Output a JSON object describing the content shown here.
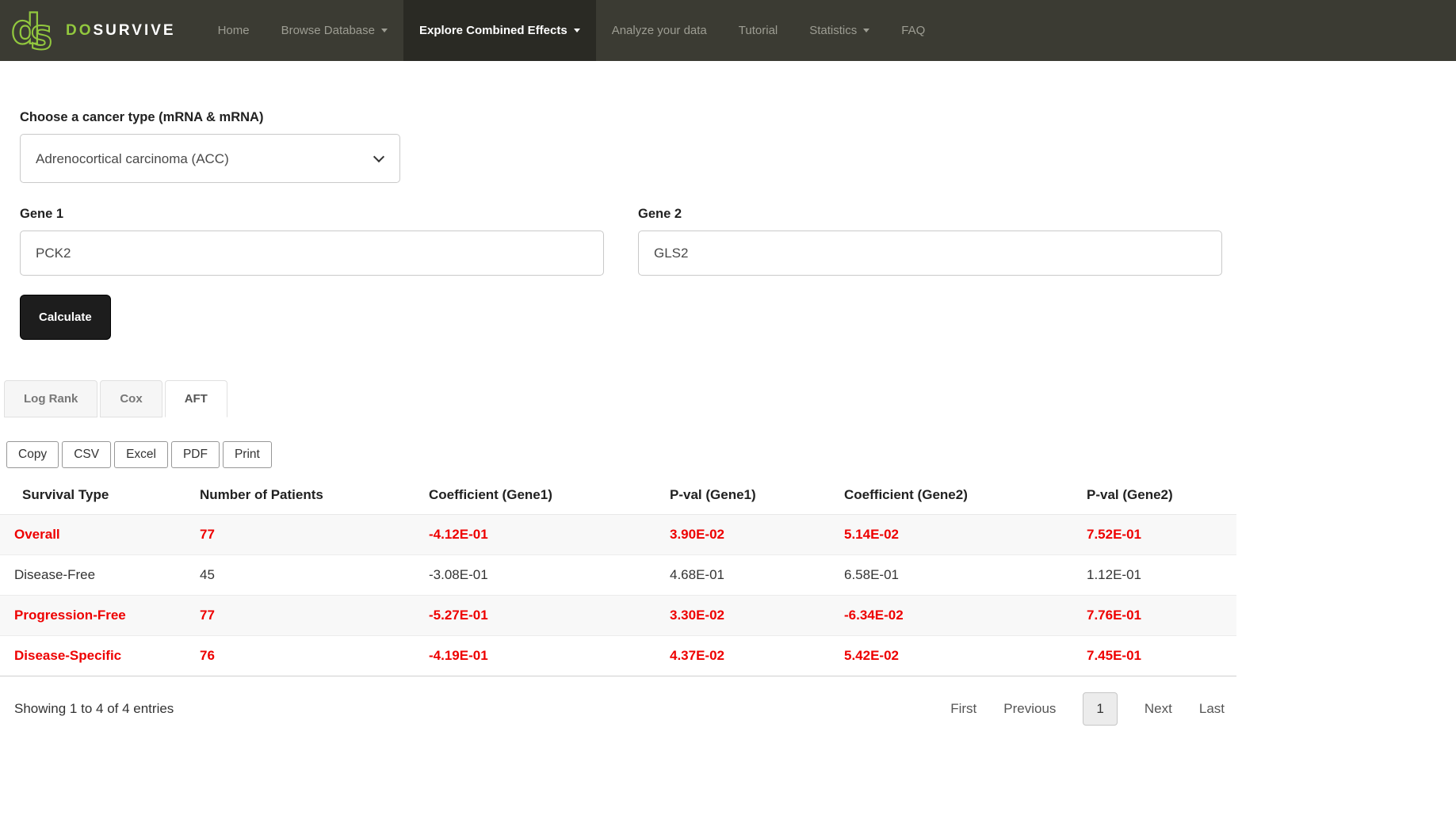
{
  "brand": {
    "green": "DO",
    "white": "SURVIVE"
  },
  "nav": {
    "items": [
      {
        "label": "Home"
      },
      {
        "label": "Browse Database"
      },
      {
        "label": "Explore Combined Effects"
      },
      {
        "label": "Analyze your data"
      },
      {
        "label": "Tutorial"
      },
      {
        "label": "Statistics"
      },
      {
        "label": "FAQ"
      }
    ]
  },
  "form": {
    "cancer_label": "Choose a cancer type (mRNA & mRNA)",
    "cancer_value": "Adrenocortical carcinoma (ACC)",
    "gene1_label": "Gene 1",
    "gene1_value": "PCK2",
    "gene2_label": "Gene 2",
    "gene2_value": "GLS2",
    "calculate_label": "Calculate"
  },
  "tabs": [
    {
      "label": "Log Rank"
    },
    {
      "label": "Cox"
    },
    {
      "label": "AFT"
    }
  ],
  "export_buttons": [
    "Copy",
    "CSV",
    "Excel",
    "PDF",
    "Print"
  ],
  "table": {
    "headers": [
      "Survival Type",
      "Number of Patients",
      "Coefficient (Gene1)",
      "P-val (Gene1)",
      "Coefficient (Gene2)",
      "P-val (Gene2)"
    ],
    "rows": [
      {
        "cells": [
          "Overall",
          "77",
          "-4.12E-01",
          "3.90E-02",
          "5.14E-02",
          "7.52E-01"
        ],
        "significant": true
      },
      {
        "cells": [
          "Disease-Free",
          "45",
          "-3.08E-01",
          "4.68E-01",
          "6.58E-01",
          "1.12E-01"
        ],
        "significant": false
      },
      {
        "cells": [
          "Progression-Free",
          "77",
          "-5.27E-01",
          "3.30E-02",
          "-6.34E-02",
          "7.76E-01"
        ],
        "significant": true
      },
      {
        "cells": [
          "Disease-Specific",
          "76",
          "-4.19E-01",
          "4.37E-02",
          "5.42E-02",
          "7.45E-01"
        ],
        "significant": true
      }
    ]
  },
  "footer": {
    "info": "Showing 1 to 4 of 4 entries",
    "first": "First",
    "previous": "Previous",
    "page": "1",
    "next": "Next",
    "last": "Last"
  },
  "colors": {
    "accent_green": "#92c83e",
    "nav_bg": "#3b3b33",
    "nav_active_bg": "#2a2a24",
    "significant_red": "#ee0000"
  }
}
